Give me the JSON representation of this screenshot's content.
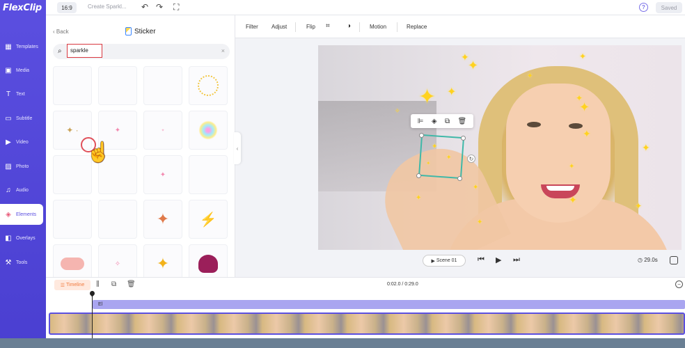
{
  "app": {
    "logo": "FlexClip"
  },
  "topbar": {
    "ratio": "16:9",
    "project_placeholder": "Create Sparkl...",
    "saved_label": "Saved",
    "help": "?"
  },
  "rail": {
    "items": [
      {
        "label": "Templates",
        "icon": "templates-icon"
      },
      {
        "label": "Media",
        "icon": "media-icon"
      },
      {
        "label": "Text",
        "icon": "text-icon"
      },
      {
        "label": "Subtitle",
        "icon": "subtitle-icon"
      },
      {
        "label": "Video",
        "icon": "video-icon"
      },
      {
        "label": "Photo",
        "icon": "photo-icon"
      },
      {
        "label": "Audio",
        "icon": "audio-icon"
      },
      {
        "label": "Elements",
        "icon": "elements-icon",
        "active": true
      },
      {
        "label": "Overlays",
        "icon": "overlays-icon"
      },
      {
        "label": "Tools",
        "icon": "tools-icon"
      }
    ]
  },
  "panel": {
    "back_label": "Back",
    "title": "Sticker",
    "search_value": "sparkle",
    "search_clear": "×"
  },
  "edit_bar": {
    "filter": "Filter",
    "adjust": "Adjust",
    "flip": "Flip",
    "motion": "Motion",
    "replace": "Replace"
  },
  "player": {
    "scene_label": "Scene 01",
    "duration": "29.0s"
  },
  "timeline": {
    "label": "Timeline",
    "time": "0:02.0 / 0:29.0",
    "track_label": "El"
  },
  "colors": {
    "accent": "#5b4fe0",
    "highlight": "#d9373f",
    "timeline_orange": "#f07a3e",
    "sparkle": "#ffd21f"
  }
}
